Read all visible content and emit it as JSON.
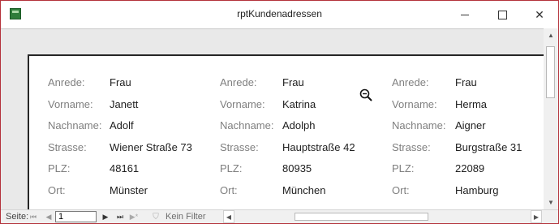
{
  "window": {
    "title": "rptKundenadressen",
    "controls": {
      "minimize": "minimize-icon",
      "maximize": "maximize-icon",
      "close": "close-icon",
      "close_glyph": "✕"
    },
    "accent_color": "#b4323b"
  },
  "report": {
    "labels": {
      "anrede": "Anrede:",
      "vorname": "Vorname:",
      "nachname": "Nachname:",
      "strasse": "Strasse:",
      "plz": "PLZ:",
      "ort": "Ort:"
    },
    "records": [
      {
        "anrede": "Frau",
        "vorname": "Janett",
        "nachname": "Adolf",
        "strasse": "Wiener Straße 73",
        "plz": "48161",
        "ort": "Münster"
      },
      {
        "anrede": "Frau",
        "vorname": "Katrina",
        "nachname": "Adolph",
        "strasse": "Hauptstraße 42",
        "plz": "80935",
        "ort": "München"
      },
      {
        "anrede": "Frau",
        "vorname": "Herma",
        "nachname": "Aigner",
        "strasse": "Burgstraße 31",
        "plz": "22089",
        "ort": "Hamburg"
      }
    ]
  },
  "statusbar": {
    "page_label": "Seite:",
    "page_value": "1",
    "filter_label": "Kein Filter",
    "glyphs": {
      "first": "⏮",
      "prev": "◀",
      "next": "▶",
      "last": "⏭",
      "new": "▶*",
      "filter": "⛉",
      "left": "◀",
      "right": "▶"
    }
  },
  "scrollbar": {
    "up": "▲",
    "down": "▼"
  },
  "icons": {
    "app": "report-icon",
    "zoom": "zoom-out-magnifier-icon"
  }
}
